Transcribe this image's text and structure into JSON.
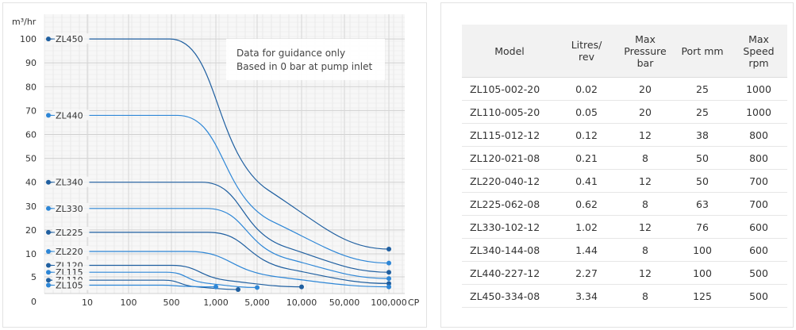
{
  "chart_data": {
    "type": "line",
    "ylabel": "m³/hr",
    "xlabel": "CP",
    "y_ticks": [
      "100",
      "90",
      "80",
      "70",
      "60",
      "50",
      "40",
      "30",
      "20",
      "10",
      "5",
      "0"
    ],
    "x_ticks": [
      "10",
      "100",
      "500",
      "1,000",
      "5,000",
      "10,000",
      "50,000",
      "100,000"
    ],
    "x_scale": "categorical-log",
    "grid": true,
    "annotation_lines": [
      "Data for guidance only",
      "Based in 0 bar at pump inlet"
    ],
    "series_colors": {
      "dark": "#1f5fa0",
      "light": "#2d86d6"
    },
    "series": [
      {
        "name": "ZL450",
        "shade": "dark",
        "start_y": 100,
        "end_x": "100,000",
        "end_y": 12
      },
      {
        "name": "ZL440",
        "shade": "light",
        "start_y": 68,
        "end_x": "100,000",
        "end_y": 8
      },
      {
        "name": "ZL340",
        "shade": "dark",
        "start_y": 40,
        "end_x": "100,000",
        "end_y": 6
      },
      {
        "name": "ZL330",
        "shade": "light",
        "start_y": 29,
        "end_x": "100,000",
        "end_y": 4.5
      },
      {
        "name": "ZL225",
        "shade": "dark",
        "start_y": 19,
        "end_x": "100,000",
        "end_y": 3
      },
      {
        "name": "ZL220",
        "shade": "light",
        "start_y": 11,
        "end_x": "100,000",
        "end_y": 2
      },
      {
        "name": "ZL120",
        "shade": "dark",
        "start_y": 7.5,
        "end_x": "10,000",
        "end_y": 2
      },
      {
        "name": "ZL115",
        "shade": "light",
        "start_y": 6,
        "end_x": "5,000",
        "end_y": 1.8
      },
      {
        "name": "ZL110",
        "shade": "dark",
        "start_y": 4,
        "end_x": "2,500",
        "end_y": 1.2
      },
      {
        "name": "ZL105",
        "shade": "light",
        "start_y": 2.5,
        "end_x": "1,000",
        "end_y": 2
      }
    ]
  },
  "table": {
    "headers": [
      [
        "Model"
      ],
      [
        "Litres/",
        "rev"
      ],
      [
        "Max",
        "Pressure",
        "bar"
      ],
      [
        "Port mm"
      ],
      [
        "Max",
        "Speed",
        "rpm"
      ]
    ],
    "rows": [
      [
        "ZL105-002-20",
        "0.02",
        "20",
        "25",
        "1000"
      ],
      [
        "ZL110-005-20",
        "0.05",
        "20",
        "25",
        "1000"
      ],
      [
        "ZL115-012-12",
        "0.12",
        "12",
        "38",
        "800"
      ],
      [
        "ZL120-021-08",
        "0.21",
        "8",
        "50",
        "800"
      ],
      [
        "ZL220-040-12",
        "0.41",
        "12",
        "50",
        "700"
      ],
      [
        "ZL225-062-08",
        "0.62",
        "8",
        "63",
        "700"
      ],
      [
        "ZL330-102-12",
        "1.02",
        "12",
        "76",
        "600"
      ],
      [
        "ZL340-144-08",
        "1.44",
        "8",
        "100",
        "600"
      ],
      [
        "ZL440-227-12",
        "2.27",
        "12",
        "100",
        "500"
      ],
      [
        "ZL450-334-08",
        "3.34",
        "8",
        "125",
        "500"
      ]
    ]
  }
}
